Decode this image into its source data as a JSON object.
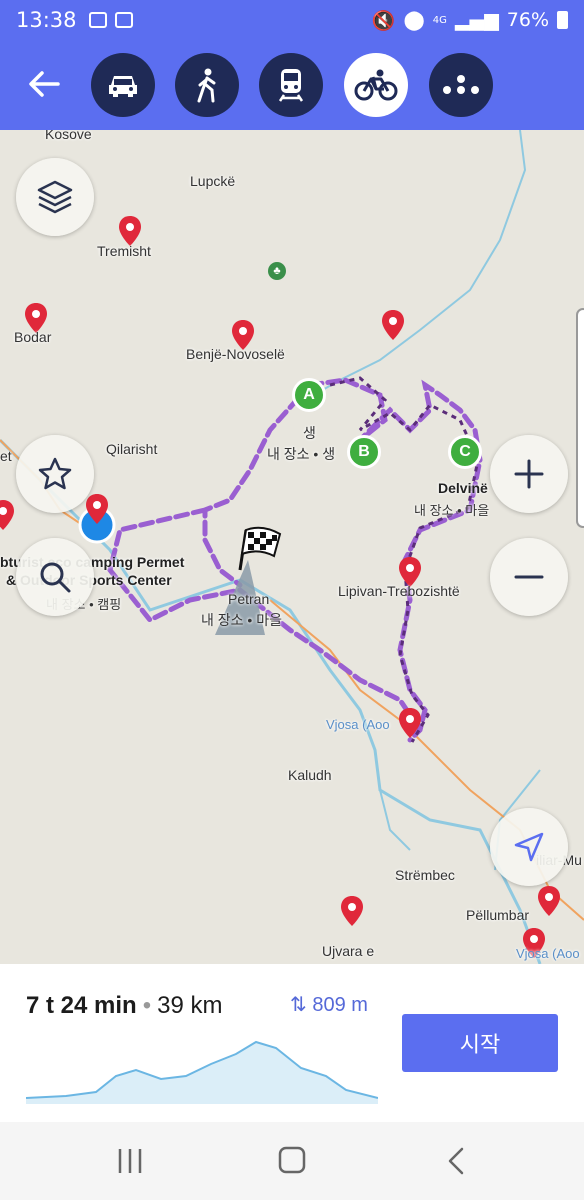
{
  "status_bar": {
    "time": "13:38",
    "network": "4G",
    "battery": "76%"
  },
  "mode_bar": {
    "back_icon": "arrow-left-icon",
    "modes": [
      {
        "name": "car",
        "icon": "car-icon",
        "active": false
      },
      {
        "name": "walk",
        "icon": "walk-icon",
        "active": false
      },
      {
        "name": "train",
        "icon": "train-icon",
        "active": false
      },
      {
        "name": "bike",
        "icon": "bike-icon",
        "active": true
      },
      {
        "name": "more",
        "icon": "more-icon",
        "active": false
      }
    ]
  },
  "map": {
    "places": {
      "kosove": "Kosove",
      "lupcke": "Lupckë",
      "tremisht": "Tremisht",
      "bodar": "Bodar",
      "benje": "Benjë-Novoselë",
      "qilarisht": "Qilarisht",
      "et": "et",
      "shaeng": "생",
      "my_place_a": "내 장소 • 생",
      "delvine": "Delvinë",
      "my_place_village_c": "내 장소 • 마을",
      "camping": "bturist eco camping Permet",
      "camping2": "& Outdoor Sports Center",
      "my_place_camping": "내 장소 • 캠핑",
      "petran": "Petran",
      "my_place_village_petran": "내 장소 • 마을",
      "lipivan": "Lipivan-Trebozishtë",
      "vjosa": "Vjosa (Aoo",
      "kaludh": "Kaludh",
      "strembec": "Strëmbec",
      "iliar": "iliar-Mu",
      "pellumbar": "Pëllumbar",
      "ujvara": "Ujvara e",
      "vjosa2": "Vjosa (Aoo"
    },
    "waypoints": [
      "A",
      "B",
      "C"
    ],
    "controls": {
      "layers_icon": "layers-icon",
      "favorites_icon": "star-icon",
      "search_icon": "search-icon",
      "zoom_in_icon": "plus-icon",
      "zoom_out_icon": "minus-icon",
      "locate_icon": "navigation-arrow-icon"
    }
  },
  "route_panel": {
    "duration": "7 t 24 min",
    "distance": "39 km",
    "ascent": "809 m",
    "start_label": "시작"
  },
  "nav_bar": {
    "recents_icon": "recents-icon",
    "home_icon": "home-icon",
    "back_icon": "back-chevron-icon"
  }
}
